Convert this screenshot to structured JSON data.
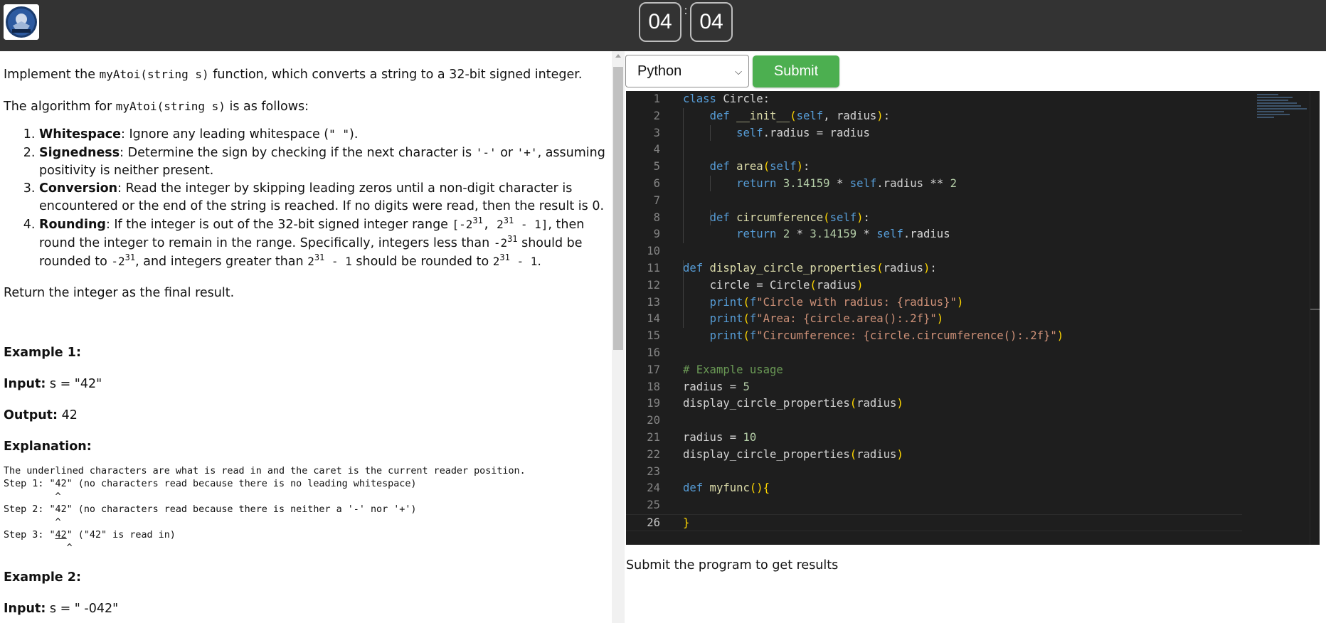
{
  "header": {
    "logo_alt": "logo",
    "timer": {
      "minutes": "04",
      "separator": ":",
      "seconds": "04"
    }
  },
  "problem": {
    "intro_before": "Implement the ",
    "intro_code": "myAtoi(string s)",
    "intro_after": " function, which converts a string to a 32-bit signed integer.",
    "algo_before": "The algorithm for ",
    "algo_code": "myAtoi(string s)",
    "algo_after": " is as follows:",
    "steps": [
      {
        "title": "Whitespace",
        "text": ": Ignore any leading whitespace (",
        "code": "\" \"",
        "tail": ")."
      },
      {
        "title": "Signedness",
        "text": ": Determine the sign by checking if the next character is ",
        "code1": "'-'",
        "mid": " or ",
        "code2": "'+'",
        "tail": ", assuming positivity is neither present."
      },
      {
        "title": "Conversion",
        "text": ": Read the integer by skipping leading zeros until a non-digit character is encountered or the end of the string is reached. If no digits were read, then the result is 0."
      },
      {
        "title": "Rounding",
        "text": ": If the integer is out of the 32-bit signed integer range "
      }
    ],
    "rounding": {
      "range_open": "[-2",
      "exp": "31",
      "range_mid": ", 2",
      "range_close": " - 1]",
      "t1": ", then round the integer to remain in the range. Specifically, integers less than ",
      "neg2": "-2",
      "t2": " should be rounded to ",
      "t3": ", and integers greater than ",
      "pos2": "2",
      "minus1": " - 1",
      "t4": " should be rounded to ",
      "end": "."
    },
    "return_text": "Return the integer as the final result.",
    "example1": {
      "heading": "Example 1:",
      "input_label": "Input:",
      "input_value": " s = \"42\"",
      "output_label": "Output:",
      "output_value": " 42",
      "explanation_label": "Explanation:",
      "exp_line1": "The underlined characters are what is read in and the caret is the current reader position.",
      "exp_line2": "Step 1: \"42\" (no characters read because there is no leading whitespace)",
      "exp_line3": "         ^",
      "exp_line4": "Step 2: \"42\" (no characters read because there is neither a '-' nor '+')",
      "exp_line5": "         ^",
      "exp_line6_a": "Step 3: \"",
      "exp_line6_u": "42",
      "exp_line6_b": "\" (\"42\" is read in)",
      "exp_line7": "           ^"
    },
    "example2": {
      "heading": "Example 2:",
      "input_label": "Input:",
      "input_value": " s = \" -042\""
    }
  },
  "toolbar": {
    "language": "Python",
    "language_options": [
      "Python"
    ],
    "submit_label": "Submit"
  },
  "editor": {
    "line_numbers": [
      "1",
      "2",
      "3",
      "4",
      "5",
      "6",
      "7",
      "8",
      "9",
      "10",
      "11",
      "12",
      "13",
      "14",
      "15",
      "16",
      "17",
      "18",
      "19",
      "20",
      "21",
      "22",
      "23",
      "24",
      "25",
      "26"
    ],
    "code": {
      "l1_kw": "class",
      "l1_name": " Circle:",
      "l2_kw": "def",
      "l2_fn": " __init__",
      "l2_open": "(",
      "l2_self": "self",
      "l2_rest": ", radius",
      "l2_close": ")",
      "l2_colon": ":",
      "l3_self": "self",
      "l3_rest": ".radius = radius",
      "l5_kw": "def",
      "l5_fn": " area",
      "l5_open": "(",
      "l5_self": "self",
      "l5_close": ")",
      "l5_colon": ":",
      "l6_kw": "return",
      "l6_num": " 3.14159",
      "l6_op": " * ",
      "l6_self": "self",
      "l6_rest": ".radius ** ",
      "l6_num2": "2",
      "l8_kw": "def",
      "l8_fn": " circumference",
      "l8_open": "(",
      "l8_self": "self",
      "l8_close": ")",
      "l8_colon": ":",
      "l9_kw": "return",
      "l9_num": " 2",
      "l9_op": " * ",
      "l9_num2": "3.14159",
      "l9_op2": " * ",
      "l9_self": "self",
      "l9_rest": ".radius",
      "l11_kw": "def",
      "l11_fn": " display_circle_properties",
      "l11_open": "(",
      "l11_arg": "radius",
      "l11_close": ")",
      "l11_colon": ":",
      "l12_a": "circle = Circle",
      "l12_open": "(",
      "l12_arg": "radius",
      "l12_close": ")",
      "l13_fn": "print",
      "l13_open": "(",
      "l13_f": "f",
      "l13_str": "\"Circle with radius: {radius}\"",
      "l13_close": ")",
      "l14_fn": "print",
      "l14_open": "(",
      "l14_f": "f",
      "l14_str": "\"Area: {circle.area():.2f}\"",
      "l14_close": ")",
      "l15_fn": "print",
      "l15_open": "(",
      "l15_f": "f",
      "l15_str": "\"Circumference: {circle.circumference():.2f}\"",
      "l15_close": ")",
      "l17_cmt": "# Example usage",
      "l18_a": "radius = ",
      "l18_num": "5",
      "l19_a": "display_circle_properties",
      "l19_open": "(",
      "l19_arg": "radius",
      "l19_close": ")",
      "l21_a": "radius = ",
      "l21_num": "10",
      "l22_a": "display_circle_properties",
      "l22_open": "(",
      "l22_arg": "radius",
      "l22_close": ")",
      "l24_kw": "def",
      "l24_fn": " myfunc",
      "l24_open": "()",
      "l24_brace": "{",
      "l26_brace": "}"
    }
  },
  "results": {
    "message": "Submit the program to get results"
  }
}
